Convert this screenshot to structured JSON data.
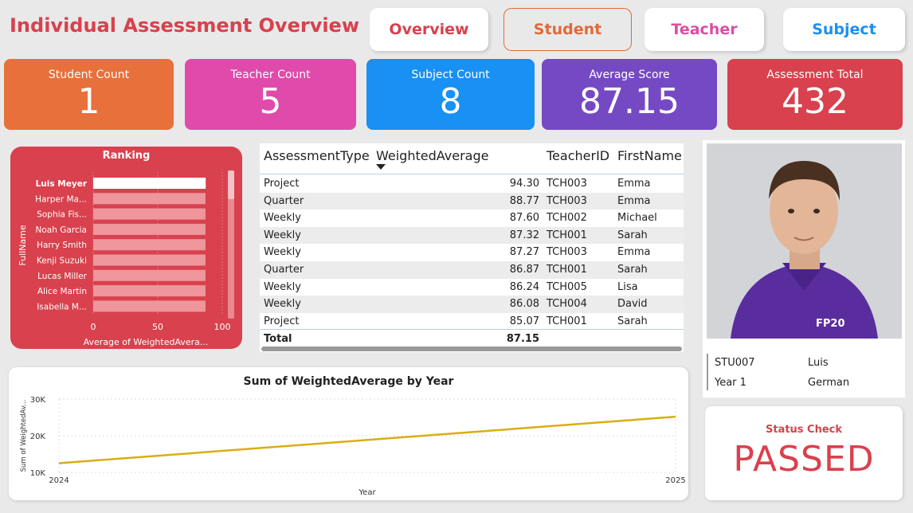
{
  "header": {
    "title": "Individual Assessment Overview"
  },
  "nav": [
    {
      "label": "Overview",
      "color": "#d8414d"
    },
    {
      "label": "Student",
      "color": "#e06a3a"
    },
    {
      "label": "Teacher",
      "color": "#d94ea4"
    },
    {
      "label": "Subject",
      "color": "#1e8ff0"
    }
  ],
  "kpis": [
    {
      "label": "Student Count",
      "value": "1",
      "color": "#e8703a"
    },
    {
      "label": "Teacher Count",
      "value": "5",
      "color": "#e04aaa"
    },
    {
      "label": "Subject Count",
      "value": "8",
      "color": "#1890f4"
    },
    {
      "label": "Average Score",
      "value": "87.15",
      "color": "#7649c4"
    },
    {
      "label": "Assessment Total",
      "value": "432",
      "color": "#d8414d"
    }
  ],
  "ranking": {
    "title": "Ranking",
    "y_axis_label": "FullName",
    "x_axis_label": "Average of WeightedAvera...",
    "ticks": [
      "0",
      "50",
      "100"
    ],
    "names": [
      "Luis Meyer",
      "Harper Ma...",
      "Sophia Fis...",
      "Noah Garcia",
      "Harry Smith",
      "Kenji Suzuki",
      "Lucas Miller",
      "Alice Martin",
      "Isabella M..."
    ],
    "values": [
      87.15,
      87,
      87,
      87,
      87,
      87,
      87,
      87,
      87
    ],
    "x_max": 100,
    "bar_color": "#ee969c",
    "highlight_color": "#ffffff"
  },
  "table": {
    "columns": [
      "AssessmentType",
      "WeightedAverage",
      "TeacherID",
      "FirstName"
    ],
    "rows": [
      [
        "Project",
        "94.30",
        "TCH003",
        "Emma"
      ],
      [
        "Quarter",
        "88.77",
        "TCH003",
        "Emma"
      ],
      [
        "Weekly",
        "87.60",
        "TCH002",
        "Michael"
      ],
      [
        "Weekly",
        "87.32",
        "TCH001",
        "Sarah"
      ],
      [
        "Weekly",
        "87.27",
        "TCH003",
        "Emma"
      ],
      [
        "Quarter",
        "86.87",
        "TCH001",
        "Sarah"
      ],
      [
        "Weekly",
        "86.24",
        "TCH005",
        "Lisa"
      ],
      [
        "Weekly",
        "86.08",
        "TCH004",
        "David"
      ],
      [
        "Project",
        "85.07",
        "TCH001",
        "Sarah"
      ]
    ],
    "total_label": "Total",
    "total_value": "87.15"
  },
  "student": {
    "id": "STU007",
    "first_name": "Luis",
    "year": "Year 1",
    "nationality": "German",
    "shirt_logo": "FP20"
  },
  "status": {
    "title": "Status Check",
    "value": "PASSED"
  },
  "chart_data": {
    "type": "line",
    "title": "Sum of WeightedAverage by Year",
    "xlabel": "Year",
    "ylabel": "Sum of WeightedAv...",
    "x": [
      "2024",
      "2025"
    ],
    "series": [
      {
        "values": [
          12500,
          25200
        ]
      }
    ],
    "yticks": [
      "10K",
      "20K",
      "30K"
    ],
    "ylim": [
      10000,
      30000
    ],
    "color": "#d9ae12",
    "grid": true
  }
}
